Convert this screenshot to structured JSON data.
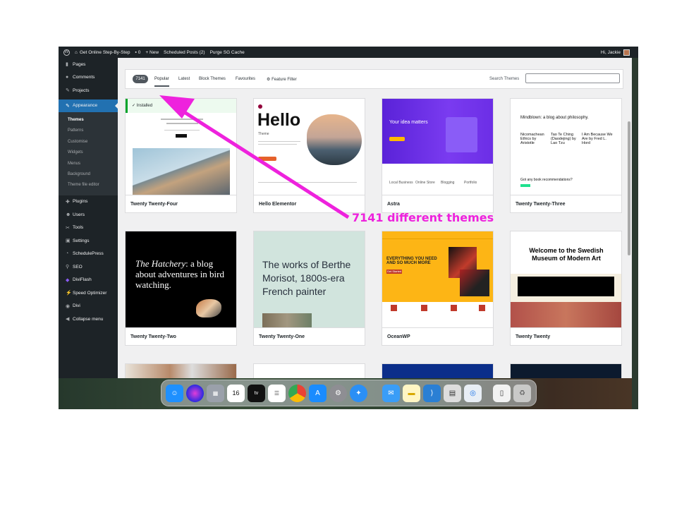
{
  "admin_bar": {
    "site_name": "Get Online Step-By-Step",
    "comments_count": "0",
    "new_label": "+ New",
    "scheduled_posts": "Scheduled Posts (2)",
    "purge_cache": "Purge SG Cache",
    "greeting": "Hi, Jackie"
  },
  "sidebar": {
    "top_items": [
      {
        "label": "Pages",
        "icon": "pages-icon"
      },
      {
        "label": "Comments",
        "icon": "comments-icon"
      },
      {
        "label": "Projects",
        "icon": "projects-icon"
      }
    ],
    "active_item": {
      "label": "Appearance",
      "icon": "appearance-icon"
    },
    "submenu": [
      "Themes",
      "Patterns",
      "Customise",
      "Widgets",
      "Menus",
      "Background",
      "Theme file editor"
    ],
    "bottom_items": [
      {
        "label": "Plugins",
        "icon": "plugins-icon"
      },
      {
        "label": "Users",
        "icon": "users-icon"
      },
      {
        "label": "Tools",
        "icon": "tools-icon"
      },
      {
        "label": "Settings",
        "icon": "settings-icon"
      },
      {
        "label": "SchedulePress",
        "icon": "schedulepress-icon"
      },
      {
        "label": "SEO",
        "icon": "seo-icon"
      },
      {
        "label": "DiviFlash",
        "icon": "diviflash-icon"
      },
      {
        "label": "Speed Optimizer",
        "icon": "speed-optimizer-icon"
      },
      {
        "label": "Divi",
        "icon": "divi-icon"
      },
      {
        "label": "Collapse menu",
        "icon": "collapse-icon"
      }
    ]
  },
  "filters": {
    "count": "7141",
    "tabs": [
      "Popular",
      "Latest",
      "Block Themes",
      "Favourites"
    ],
    "feature_filter": "Feature Filter",
    "search_label": "Search Themes",
    "search_value": ""
  },
  "themes": [
    {
      "name": "Twenty Twenty-Four",
      "installed_label": "Installed"
    },
    {
      "name": "Hello Elementor",
      "headline": "Hello",
      "sub": "Theme"
    },
    {
      "name": "Astra",
      "headline": "Your idea matters",
      "features": [
        "Local Business",
        "Online Store",
        "Blogging",
        "Portfolio"
      ]
    },
    {
      "name": "Twenty Twenty-Three",
      "headline": "Mindblown: a blog about philosophy.",
      "cols": [
        "Nicomachean Ethics by Aristotle",
        "Tao Te Ching (Daodejing) by Lao Tzu",
        "I Am Because We Are by Fred L. Hord"
      ],
      "footer": "Got any book recommendations?"
    },
    {
      "name": "Twenty Twenty-Two",
      "headline_em": "The Hatchery",
      "headline_rest": ": a blog about adventures in bird watching."
    },
    {
      "name": "Twenty Twenty-One",
      "headline": "The works of Berthe Morisot, 1800s-era French painter"
    },
    {
      "name": "OceanWP",
      "headline": "EVERYTHING YOU NEED AND SO MUCH MORE",
      "btn": "Get Started"
    },
    {
      "name": "Twenty Twenty",
      "headline": "Welcome to the Swedish Museum of Modern Art"
    }
  ],
  "annotation": "7141 different themes",
  "colors": {
    "accent": "#2271b1",
    "annotation": "#ee22dd",
    "admin_dark": "#1d2327"
  }
}
